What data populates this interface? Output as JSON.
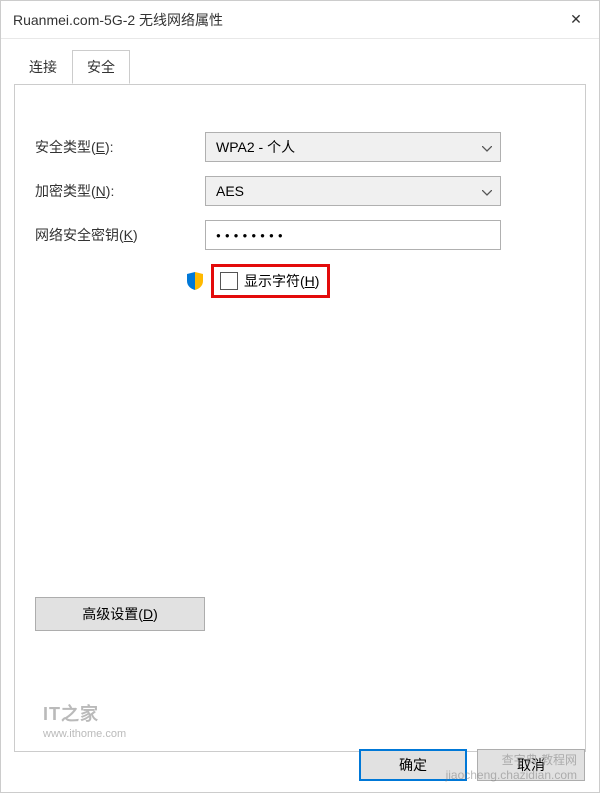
{
  "window": {
    "title": "Ruanmei.com-5G-2 无线网络属性",
    "close_glyph": "✕"
  },
  "tabs": {
    "connection": "连接",
    "security": "安全"
  },
  "form": {
    "security_type_label_pre": "安全类型(",
    "security_type_label_u": "E",
    "security_type_label_post": "):",
    "security_type_value": "WPA2 - 个人",
    "encryption_type_label_pre": "加密类型(",
    "encryption_type_label_u": "N",
    "encryption_type_label_post": "):",
    "encryption_type_value": "AES",
    "network_key_label_pre": "网络安全密钥(",
    "network_key_label_u": "K",
    "network_key_label_post": ")",
    "network_key_value": "●●●●●●●●",
    "show_chars_label_pre": "显示字符(",
    "show_chars_label_u": "H",
    "show_chars_label_post": ")"
  },
  "advanced": {
    "label_pre": "高级设置(",
    "label_u": "D",
    "label_post": ")"
  },
  "buttons": {
    "ok": "确定",
    "cancel": "取消"
  },
  "watermark": {
    "logo": "IT之家",
    "url": "www.ithome.com",
    "wm2_line1": "查字典 教程网",
    "wm2_line2": "jiaocheng.chazidian.com"
  }
}
